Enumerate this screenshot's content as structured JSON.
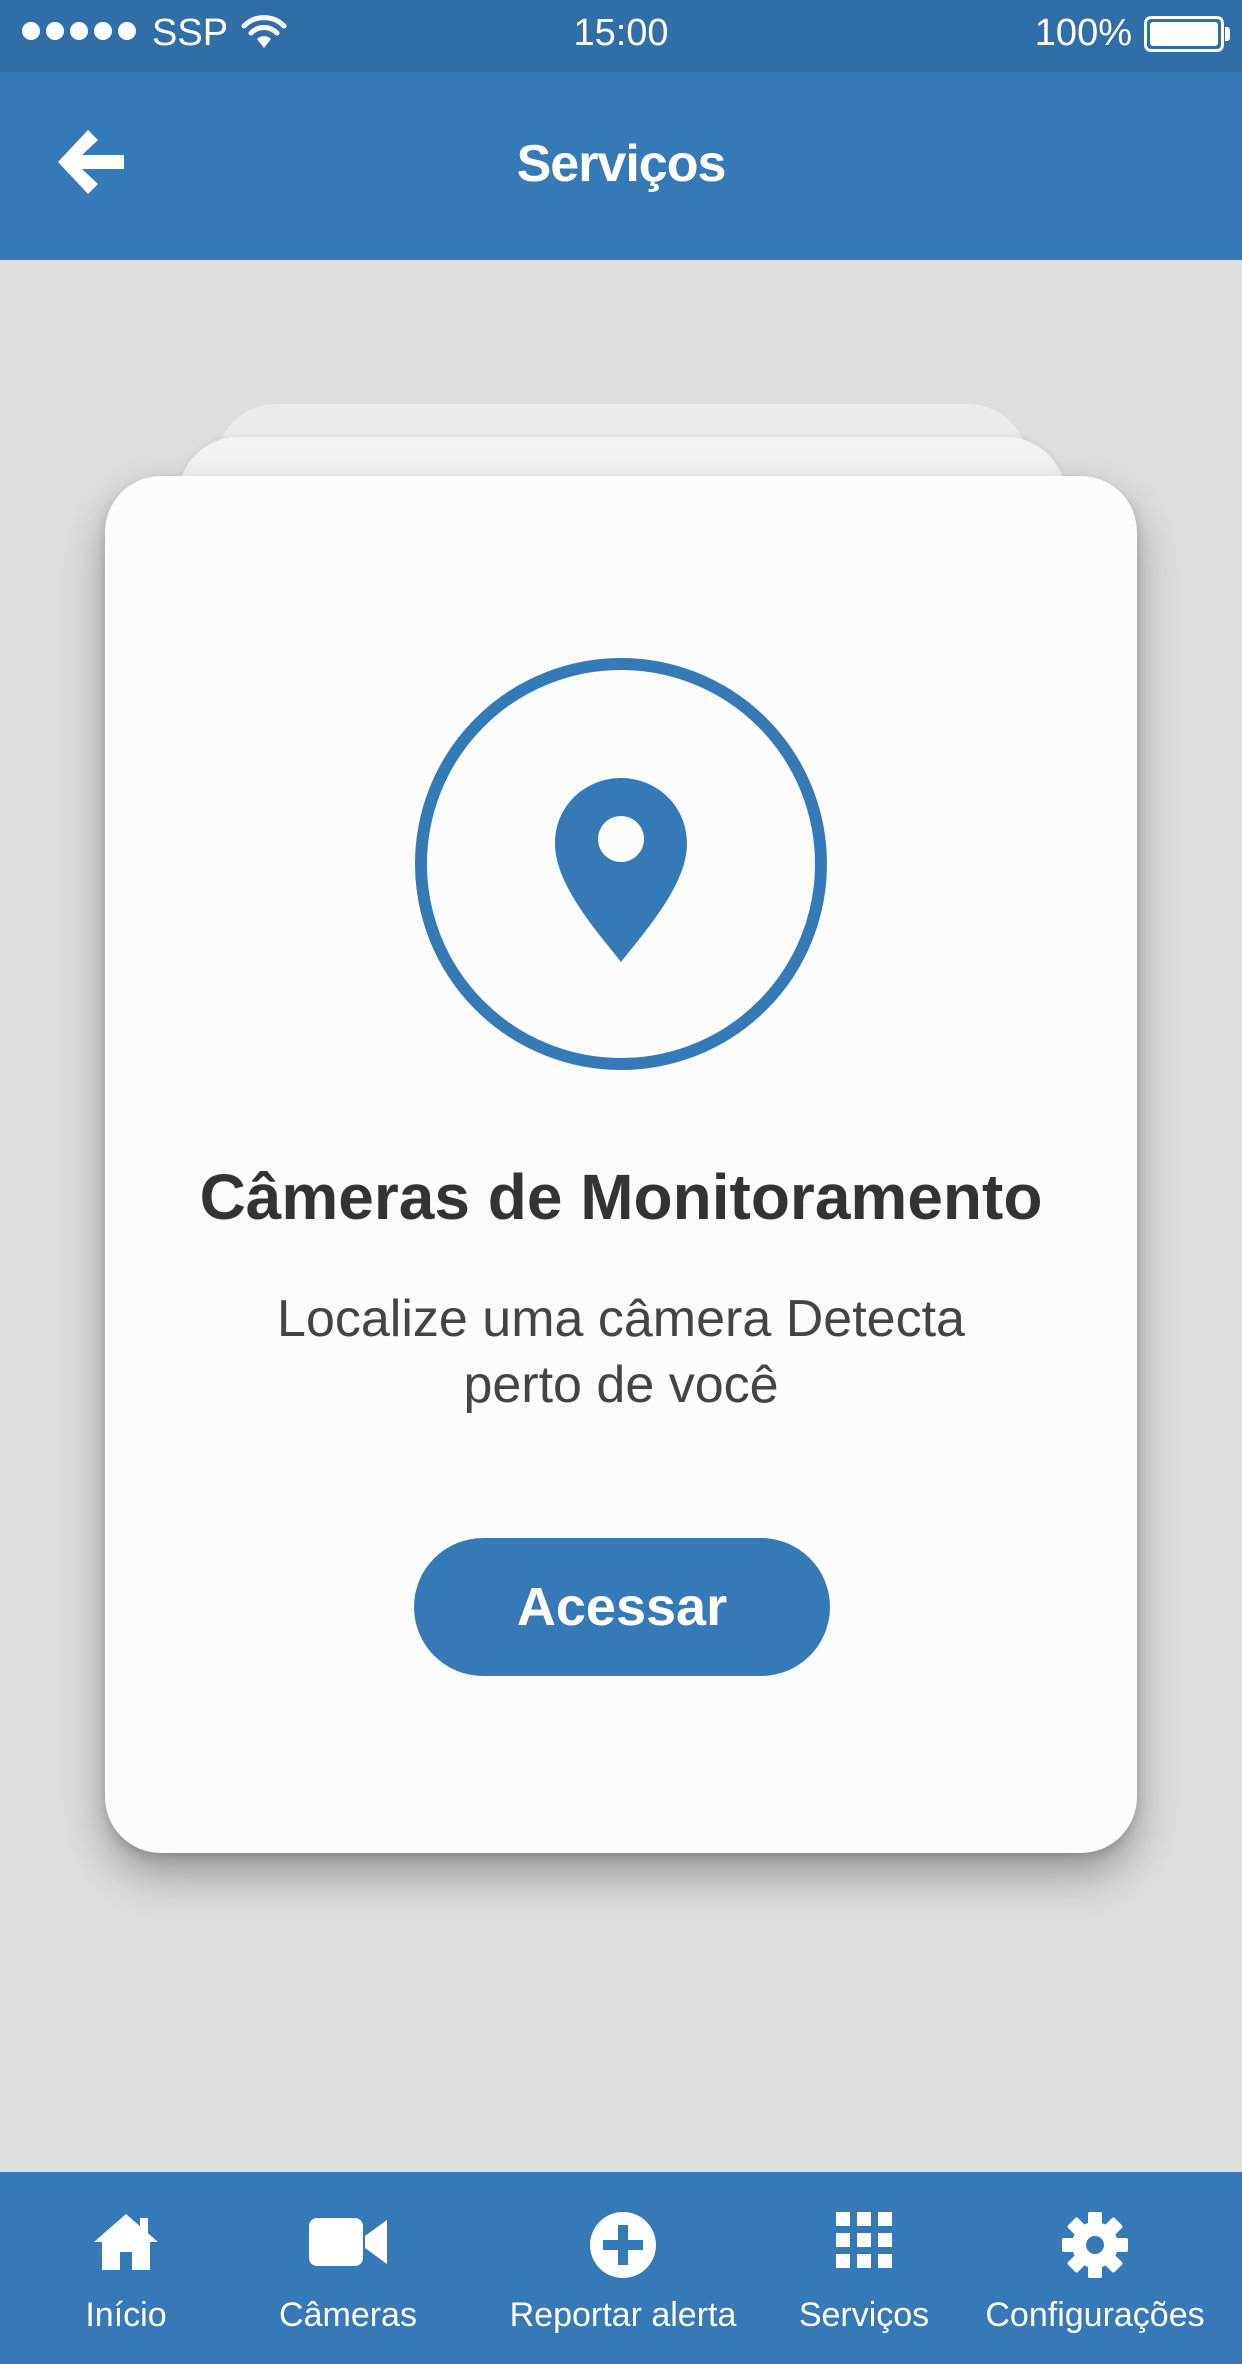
{
  "status_bar": {
    "carrier": "SSP",
    "time": "15:00",
    "battery": "100%"
  },
  "header": {
    "title": "Serviços",
    "back_icon": "arrow-left-icon"
  },
  "card": {
    "icon": "map-pin-icon",
    "title": "Câmeras de Monitoramento",
    "description": "Localize uma câmera Detecta perto de você",
    "button_label": "Acessar"
  },
  "tabbar": {
    "items": [
      {
        "label": "Início",
        "icon": "home-icon"
      },
      {
        "label": "Câmeras",
        "icon": "video-camera-icon"
      },
      {
        "label": "Reportar alerta",
        "icon": "plus-circle-icon"
      },
      {
        "label": "Serviços",
        "icon": "grid-icon"
      },
      {
        "label": "Configurações",
        "icon": "gear-icon"
      }
    ]
  },
  "colors": {
    "primary": "#3679b7",
    "status_bar": "#2f6ea6",
    "background": "#dedede",
    "card": "#fcfcfc",
    "text_dark": "#333333"
  }
}
